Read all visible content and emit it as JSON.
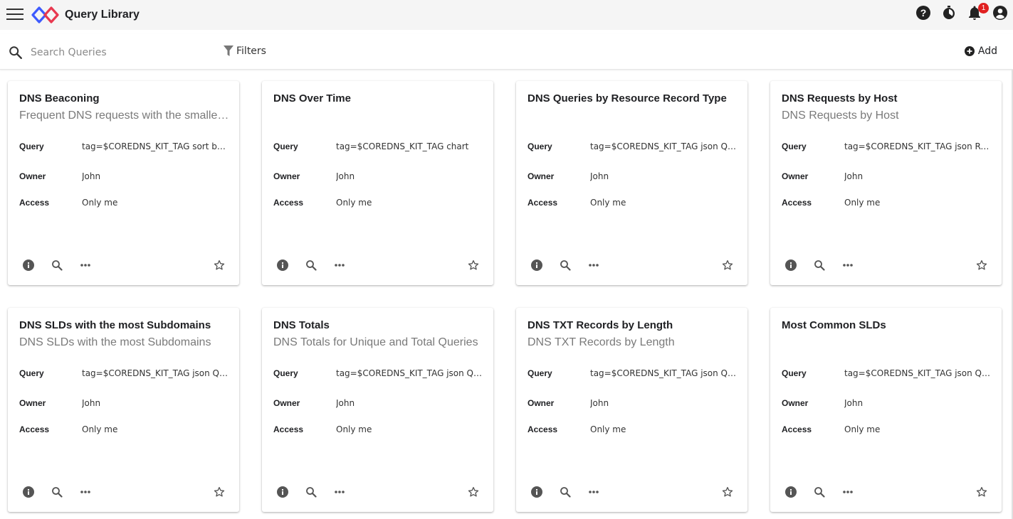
{
  "app": {
    "title": "Query Library"
  },
  "header": {
    "notification_count": "1"
  },
  "search": {
    "placeholder": "Search Queries"
  },
  "toolbar": {
    "filters_label": "Filters",
    "add_label": "Add"
  },
  "labels": {
    "query": "Query",
    "owner": "Owner",
    "access": "Access"
  },
  "colors": {
    "logo_red": "#e8384f",
    "logo_blue": "#3d5afe",
    "badge": "#e02020"
  },
  "cards": [
    {
      "title": "DNS Beaconing",
      "subtitle": "Frequent DNS requests with the smallest time interval",
      "query": "tag=$COREDNS_KIT_TAG sort by time",
      "owner": "John",
      "access": "Only me"
    },
    {
      "title": "DNS Over Time",
      "subtitle": "",
      "query": "tag=$COREDNS_KIT_TAG chart",
      "owner": "John",
      "access": "Only me"
    },
    {
      "title": "DNS Queries by Resource Record Type",
      "subtitle": "",
      "query": "tag=$COREDNS_KIT_TAG json Question.Type",
      "owner": "John",
      "access": "Only me"
    },
    {
      "title": "DNS Requests by Host",
      "subtitle": "DNS Requests by Host",
      "query": "tag=$COREDNS_KIT_TAG json Remote",
      "owner": "John",
      "access": "Only me"
    },
    {
      "title": "DNS SLDs with the most Subdomains",
      "subtitle": "DNS SLDs with the most Subdomains",
      "query": "tag=$COREDNS_KIT_TAG json Question.Hdr.Name",
      "owner": "John",
      "access": "Only me"
    },
    {
      "title": "DNS Totals",
      "subtitle": "DNS Totals for Unique and Total Queries",
      "query": "tag=$COREDNS_KIT_TAG json Question.Hdr.Name",
      "owner": "John",
      "access": "Only me"
    },
    {
      "title": "DNS TXT Records by Length",
      "subtitle": "DNS TXT Records by Length",
      "query": "tag=$COREDNS_KIT_TAG json Question.Type",
      "owner": "John",
      "access": "Only me"
    },
    {
      "title": "Most Common SLDs",
      "subtitle": "",
      "query": "tag=$COREDNS_KIT_TAG json Question.Hdr.Name",
      "owner": "John",
      "access": "Only me"
    }
  ]
}
